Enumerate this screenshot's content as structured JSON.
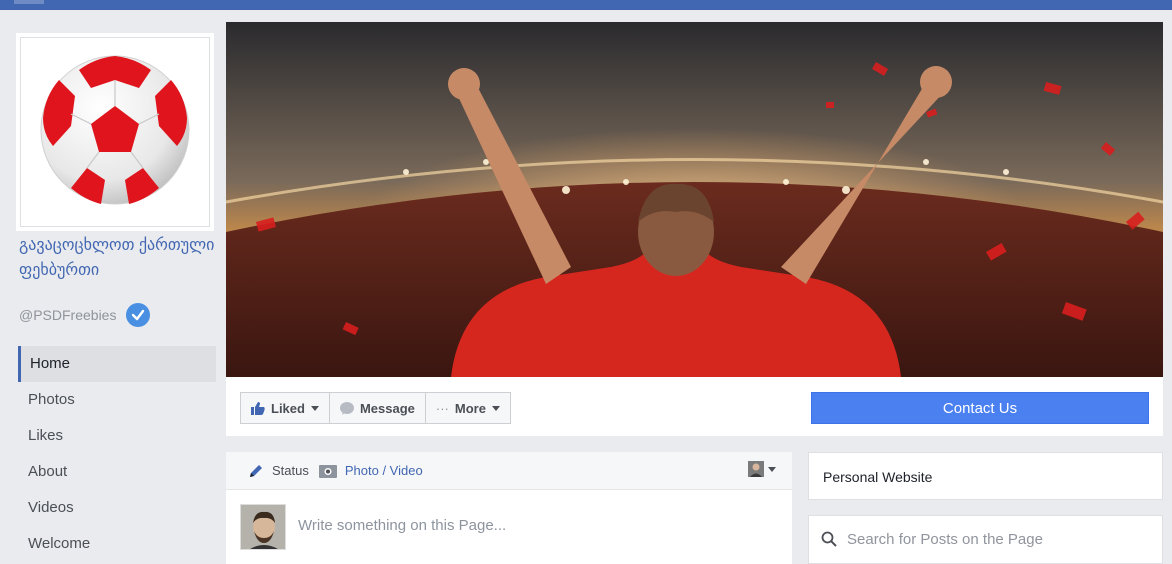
{
  "page": {
    "name": "გავაცოცხლოთ ქართული ფეხბურთი",
    "handle": "@PSDFreebies"
  },
  "nav": [
    {
      "label": "Home",
      "active": true
    },
    {
      "label": "Photos"
    },
    {
      "label": "Likes"
    },
    {
      "label": "About"
    },
    {
      "label": "Videos"
    },
    {
      "label": "Welcome"
    }
  ],
  "actions": {
    "liked": "Liked",
    "message": "Message",
    "more_dots": "···",
    "more": "More",
    "contact": "Contact Us"
  },
  "composer": {
    "status": "Status",
    "photo_video": "Photo / Video",
    "placeholder": "Write something on this Page..."
  },
  "sidebar": {
    "website": "Personal Website",
    "search_placeholder": "Search for Posts on the Page"
  },
  "icons": {
    "verified": "verified-check-icon",
    "liked": "thumbs-up-icon",
    "message": "speech-bubble-icon",
    "status": "pencil-icon",
    "photo": "camera-icon",
    "search": "magnifier-icon"
  },
  "colors": {
    "brand": "#4267b2",
    "contact_button": "#4a80f0",
    "ball_red": "#e0141c"
  }
}
